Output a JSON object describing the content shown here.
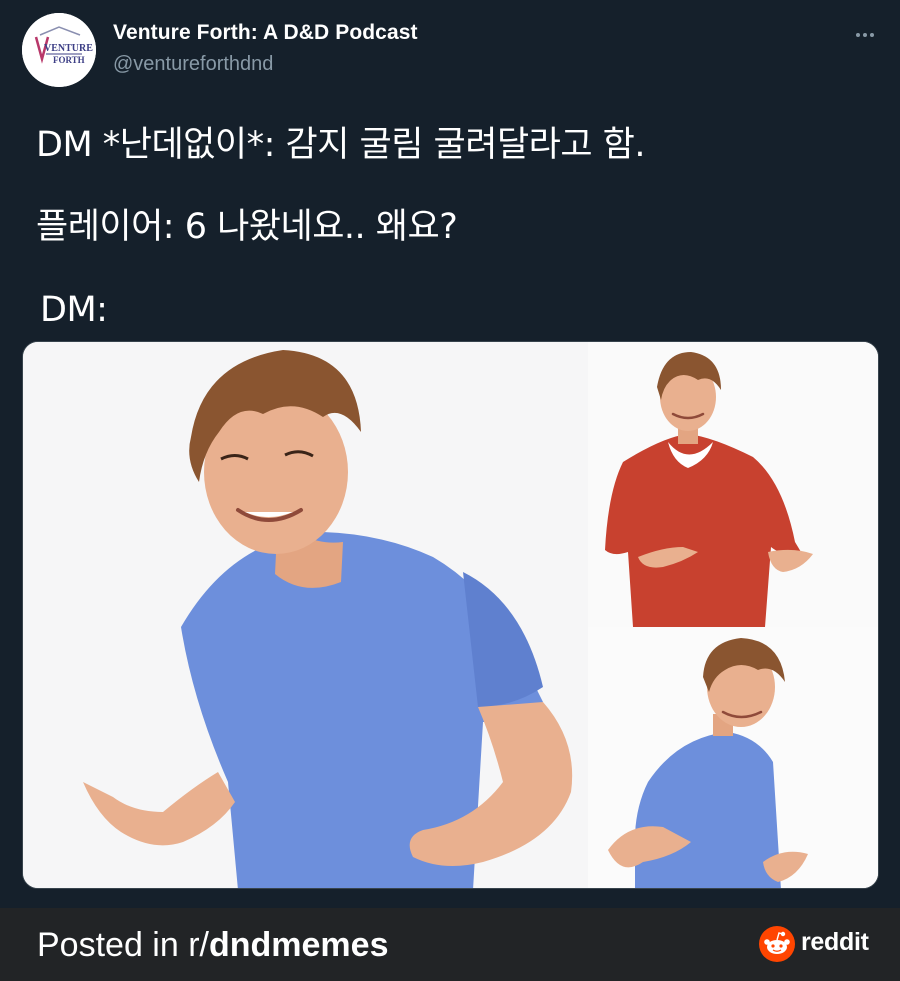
{
  "tweet": {
    "author_name": "Venture Forth: A D&D Podcast",
    "author_handle": "@ventureforthdnd",
    "avatar_logo_text": [
      "VENTURE",
      "FORTH"
    ],
    "lines": [
      "DM *난데없이*: 감지 굴림 굴려달라고 함.",
      "플레이어: 6 나왔네요.. 왜요?",
      "DM:"
    ]
  },
  "media": {
    "alt": "Zac Efron shrugging meme (three panels)",
    "colors": {
      "blue_shirt": "#6d8fdc",
      "red_sweater": "#c8412f",
      "skin": "#e9b08f",
      "hair": "#8a5530"
    }
  },
  "footer": {
    "prefix": "Posted in r/",
    "subreddit": "dndmemes",
    "brand": "reddit",
    "accent": "#ff4500"
  }
}
